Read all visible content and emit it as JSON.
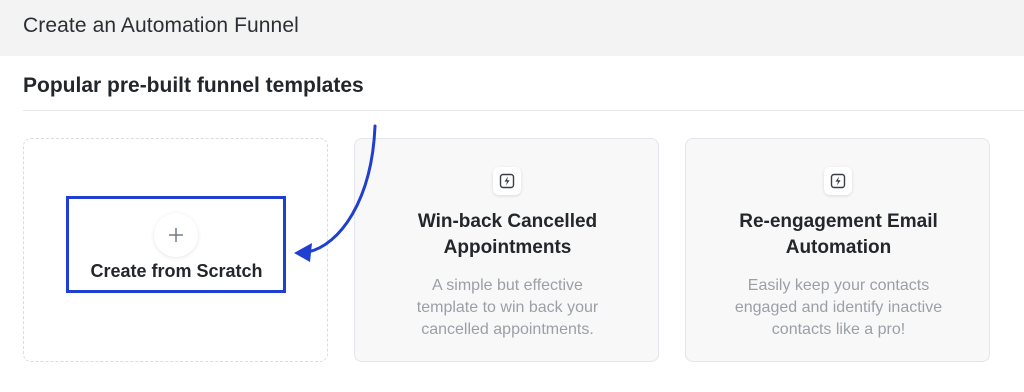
{
  "header": {
    "title": "Create an Automation Funnel"
  },
  "templates_section": {
    "title": "Popular pre-built funnel templates"
  },
  "scratch_card": {
    "icon": "plus-icon",
    "label": "Create from Scratch"
  },
  "template_cards": [
    {
      "icon": "lightning-bolt-icon",
      "title_lines": [
        "Win-back Cancelled",
        "Appointments"
      ],
      "description_lines": [
        "A simple but effective",
        "template to win back your",
        "cancelled appointments."
      ]
    },
    {
      "icon": "lightning-bolt-icon",
      "title_lines": [
        "Re-engagement Email",
        "Automation"
      ],
      "description_lines": [
        "Easily keep your contacts",
        "engaged and identify inactive",
        "contacts like a pro!"
      ]
    }
  ],
  "annotation": {
    "highlight_color": "#1f3fd1",
    "arrow_color": "#1f3fd1"
  }
}
